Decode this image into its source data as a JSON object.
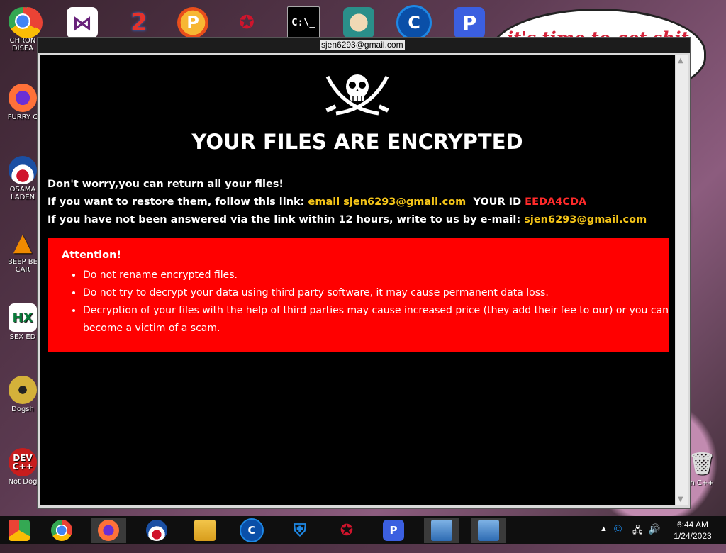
{
  "desktop": {
    "left_icons": [
      {
        "label": "CHRON DISEA",
        "icon": "chrome-icon"
      },
      {
        "label": "FURRY C",
        "icon": "firefox-icon"
      },
      {
        "label": "OSAMA LADEN",
        "icon": "obama-logo-icon"
      },
      {
        "label": "BEEP BE CAR",
        "icon": "vlc-icon"
      },
      {
        "label": "SEX ED",
        "icon": "hx-icon"
      },
      {
        "label": "Dogsh",
        "icon": "disc-icon"
      },
      {
        "label": "Not Dog",
        "icon": "devcpp-icon"
      }
    ],
    "right_icon_label": "n C++",
    "bubble_text": "it's time to get shit",
    "top_icons": [
      "chrome-icon",
      "visual-studio-icon",
      "number-two-icon",
      "p-ball-icon",
      "red-emblem-icon",
      "terminal-icon",
      "cartoon-icon",
      "c-circle-icon",
      "p-app-icon"
    ]
  },
  "window": {
    "title": "sjen6293@gmail.com",
    "headline": "YOUR FILES ARE ENCRYPTED",
    "line1": "Don't worry,you can return all your files!",
    "line2_prefix": "If you want to restore them, follow this link:",
    "line2_link": "email sjen6293@gmail.com",
    "line2_id_label": "YOUR ID",
    "line2_id_value": "EEDA4CDA",
    "line3_prefix": "If you have not been answered via the link within 12 hours, write to us by e-mail:",
    "line3_email": "sjen6293@gmail.com",
    "attention_title": "Attention!",
    "attention_items": [
      "Do not rename encrypted files.",
      "Do not try to decrypt your data using third party software, it may cause permanent data loss.",
      "Decryption of your files with the help of third parties may cause increased price (they add their fee to our) or you can become a victim of a scam."
    ]
  },
  "taskbar": {
    "items": [
      "chrome-alt-icon",
      "chrome-icon",
      "firefox-icon",
      "obama-logo-icon",
      "file-explorer-icon",
      "c-circle-icon",
      "shield-icon",
      "red-emblem-icon",
      "p-app-icon",
      "network-computer-icon",
      "network-computer-icon"
    ],
    "clock_time": "6:44 AM",
    "clock_date": "1/24/2023"
  },
  "colors": {
    "accent_yellow": "#f5c518",
    "id_red": "#ff2a2a",
    "attention_bg": "#ff0000"
  }
}
